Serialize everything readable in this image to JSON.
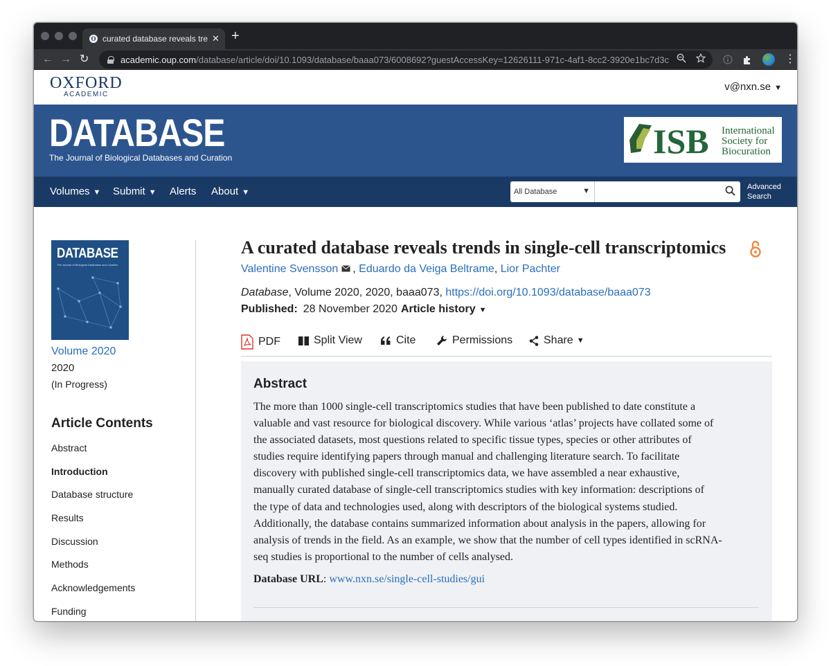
{
  "browser": {
    "tab_title": "curated database reveals trends",
    "tab_favicon": "O",
    "url_host": "academic.oup.com",
    "url_path": "/database/article/doi/10.1093/database/baaa073/6008692?guestAccessKey=12626111-971c-4af1-8cc2-3920e1bc7d3c",
    "icons": [
      "back-icon",
      "forward-icon",
      "reload-icon",
      "lock-icon",
      "zoom-icon",
      "star-icon",
      "info-icon",
      "extensions-icon",
      "profile-avatar",
      "menu-dots-icon"
    ]
  },
  "header": {
    "oxford": "OXFORD",
    "academic": "ACADEMIC",
    "user": "v@nxn.se"
  },
  "banner": {
    "title": "DATABASE",
    "subtitle": "The Journal of Biological Databases and Curation",
    "isb_name": "ISB",
    "isb_text": [
      "International",
      "Society for",
      "Biocuration"
    ]
  },
  "nav": {
    "items": [
      "Volumes",
      "Submit",
      "Alerts",
      "About"
    ],
    "search_scope": "All Database",
    "search_placeholder": "",
    "advanced": [
      "Advanced",
      "Search"
    ]
  },
  "sidebar": {
    "cover_title": "DATABASE",
    "cover_subtitle": "The Journal of Biological Databases and Curation",
    "volume_link": "Volume 2020",
    "year": "2020",
    "status": "(In Progress)",
    "toc_heading": "Article Contents",
    "toc": [
      {
        "label": "Abstract",
        "active": false
      },
      {
        "label": "Introduction",
        "active": true
      },
      {
        "label": "Database structure",
        "active": false
      },
      {
        "label": "Results",
        "active": false
      },
      {
        "label": "Discussion",
        "active": false
      },
      {
        "label": "Methods",
        "active": false
      },
      {
        "label": "Acknowledgements",
        "active": false
      },
      {
        "label": "Funding",
        "active": false
      }
    ]
  },
  "article": {
    "title": "A curated database reveals trends in single-cell transcriptomics",
    "authors": [
      "Valentine Svensson",
      "Eduardo da Veiga Beltrame",
      "Lior Pachter"
    ],
    "journal": "Database",
    "citation_rest": ", Volume 2020, 2020, baaa073, ",
    "doi": "https://doi.org/10.1093/database/baaa073",
    "published_label": "Published:",
    "published_date": "28 November 2020",
    "history_label": "Article history",
    "actions": [
      "PDF",
      "Split View",
      "Cite",
      "Permissions",
      "Share"
    ],
    "abstract_heading": "Abstract",
    "abstract_lines": [
      "The more than 1000 single-cell transcriptomics studies that have been published to date constitute a",
      "valuable and vast resource for biological discovery. While various ‘atlas’ projects have collated some of",
      "the associated datasets, most questions related to specific tissue types, species or other attributes of",
      "studies require identifying papers through manual and challenging literature search. To facilitate",
      "discovery with published single-cell transcriptomics data, we have assembled a near exhaustive,",
      "manually curated database of single-cell transcriptomics studies with key information: descriptions of",
      "the type of data and technologies used, along with descriptors of the biological systems studied.",
      "Additionally, the database contains summarized information about analysis in the papers, allowing for",
      "analysis of trends in the field. As an example, we show that the number of cell types identified in scRNA-",
      "seq studies is proportional to the number of cells analysed."
    ],
    "db_url_label": "Database URL",
    "db_url": "www.nxn.se/single-cell-studies/gui"
  },
  "colors": {
    "banner": "#2c558e",
    "navbar": "#1a3a66",
    "link": "#2a6ebb",
    "open_access": "#f0883a",
    "pdf_red": "#d9342b",
    "abstract_bg": "#eff1f4"
  }
}
